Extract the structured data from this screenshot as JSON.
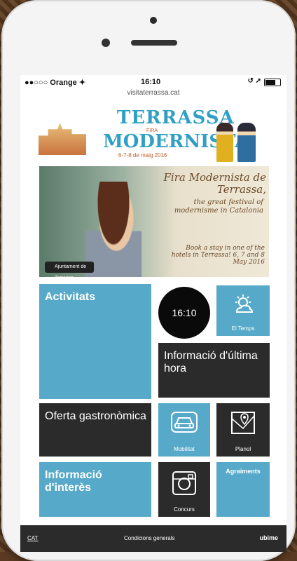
{
  "status": {
    "carrier": "●●○○○ Orange ✦",
    "time": "16:10",
    "indicators": "↺ ➚"
  },
  "browser": {
    "url": "visitaterrassa.cat"
  },
  "logo": {
    "line1": "TERRASSA",
    "sub": "FIRA",
    "line2": "MODERNISTA",
    "date": "6-7-8 de maig 2016"
  },
  "banner": {
    "title": "Fira Modernista de Terrassa,",
    "subtitle": "the great festival of modernisme in Catalonia",
    "book": "Book a stay in one of the hotels in Terrassa! 6, 7 and 8 May 2016",
    "badge": "Ajuntament de Terrassa"
  },
  "tiles": {
    "activitats": "Activitats",
    "clock": "16:10",
    "temps": "El Temps",
    "informacio_hora": "Informació d'última hora",
    "oferta": "Oferta gastronòmica",
    "mobilitat": "Mobilitat",
    "planol": "Planol",
    "informacio_interes": "Informació d'interès",
    "concurs": "Concurs",
    "agraiments": "Agraïments"
  },
  "footer": {
    "lang": "CAT",
    "conditions": "Condicions generals",
    "brand": "ubime"
  },
  "colors": {
    "tile_blue": "#57a9c9",
    "tile_dark": "#2b2b2b",
    "accent_orange": "#c45b2d"
  }
}
